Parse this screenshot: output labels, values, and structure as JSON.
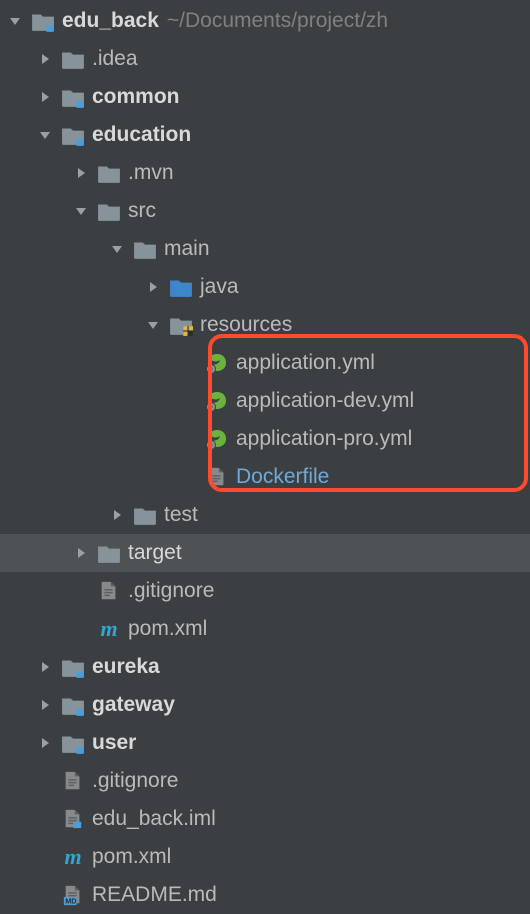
{
  "root": {
    "name": "edu_back",
    "path": "~/Documents/project/zh"
  },
  "items": {
    "idea": ".idea",
    "common": "common",
    "education": "education",
    "mvn": ".mvn",
    "src": "src",
    "main": "main",
    "java": "java",
    "resources": "resources",
    "app_yml": "application.yml",
    "app_dev": "application-dev.yml",
    "app_pro": "application-pro.yml",
    "dockerfile": "Dockerfile",
    "test": "test",
    "target": "target",
    "gitignore_inner": ".gitignore",
    "pom_inner": "pom.xml",
    "eureka": "eureka",
    "gateway": "gateway",
    "user": "user",
    "gitignore_outer": ".gitignore",
    "iml": "edu_back.iml",
    "pom_outer": "pom.xml",
    "readme": "README.md"
  }
}
